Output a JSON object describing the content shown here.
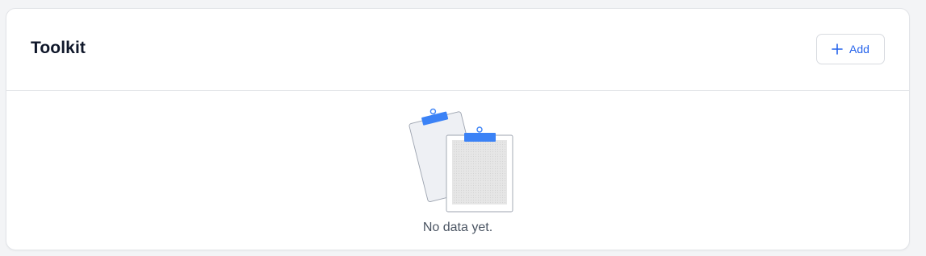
{
  "card": {
    "title": "Toolkit",
    "add_button_label": "Add"
  },
  "empty_state": {
    "message": "No data yet.",
    "icon": "clipboard-stack-icon"
  },
  "colors": {
    "accent": "#2563eb",
    "clip": "#3b82f6",
    "page_bg": "#f3f4f6"
  }
}
